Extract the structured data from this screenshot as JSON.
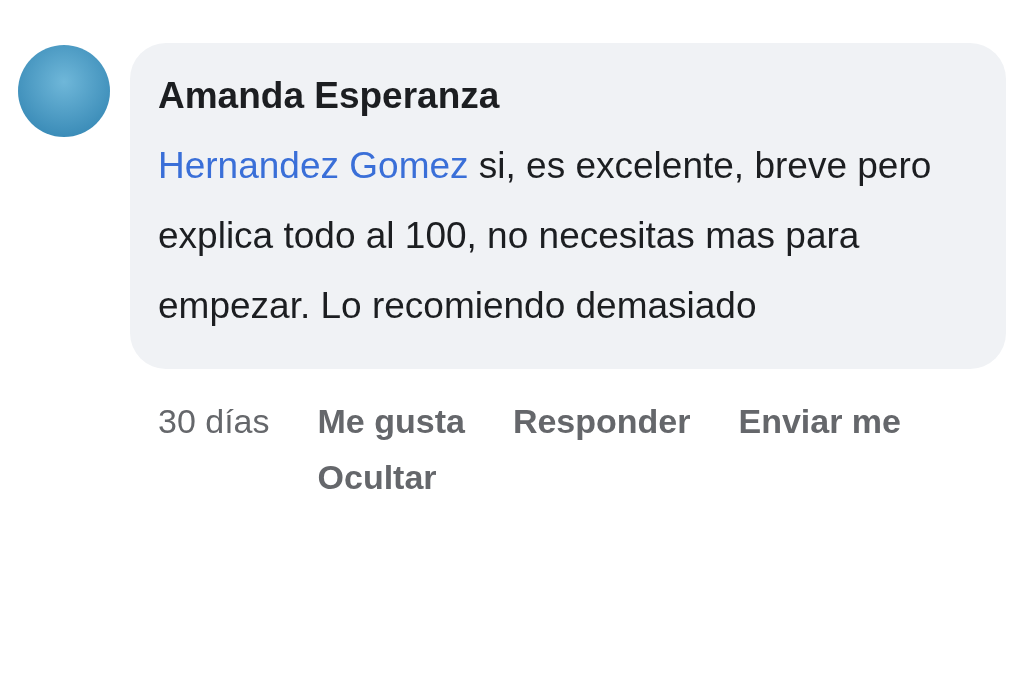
{
  "comment": {
    "author": "Amanda Esperanza",
    "mention": "Hernandez Gomez",
    "text": "si, es excelente, breve pero explica todo al 100, no necesitas mas para empezar. Lo recomiendo demasiado",
    "time": "30 días",
    "actions": [
      {
        "label": "Me gusta"
      },
      {
        "label": "Responder"
      },
      {
        "label": "Enviar me"
      },
      {
        "label": "Ocultar"
      }
    ]
  }
}
